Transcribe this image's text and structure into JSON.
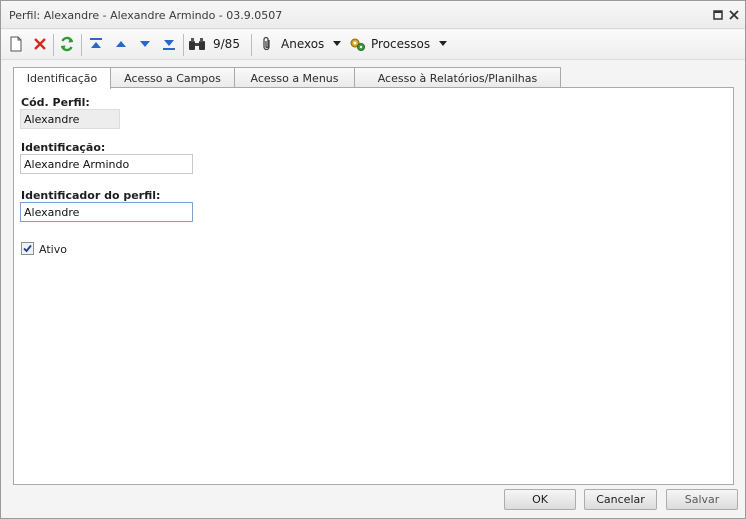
{
  "window": {
    "title": "Perfil: Alexandre - Alexandre Armindo - 03.9.0507"
  },
  "toolbar": {
    "record_counter": "9/85",
    "attachments_label": "Anexos",
    "processes_label": "Processos"
  },
  "tabs": [
    {
      "label": "Identificação",
      "active": true
    },
    {
      "label": "Acesso a Campos",
      "active": false
    },
    {
      "label": "Acesso a Menus",
      "active": false
    },
    {
      "label": "Acesso à Relatórios/Planilhas",
      "active": false
    }
  ],
  "form": {
    "cod_perfil": {
      "label": "Cód. Perfil:",
      "value": "Alexandre"
    },
    "identificacao": {
      "label": "Identificação:",
      "value": "Alexandre Armindo"
    },
    "identificador": {
      "label": "Identificador do perfil:",
      "value": "Alexandre"
    },
    "ativo": {
      "label": "Ativo",
      "checked": true
    }
  },
  "footer": {
    "ok_label": "OK",
    "cancel_label": "Cancelar",
    "save_label": "Salvar"
  },
  "icons": {
    "new": "new-document-icon",
    "delete": "delete-icon",
    "refresh": "refresh-icon",
    "first": "first-record-icon",
    "previous": "previous-record-icon",
    "next": "next-record-icon",
    "last": "last-record-icon",
    "search": "binoculars-icon",
    "attachments": "paperclip-icon",
    "processes": "gears-icon"
  },
  "colors": {
    "delete_red": "#d42a1f",
    "refresh_green": "#2f9a2f",
    "nav_blue": "#2a67c8",
    "focus_border": "#7da2ce"
  }
}
